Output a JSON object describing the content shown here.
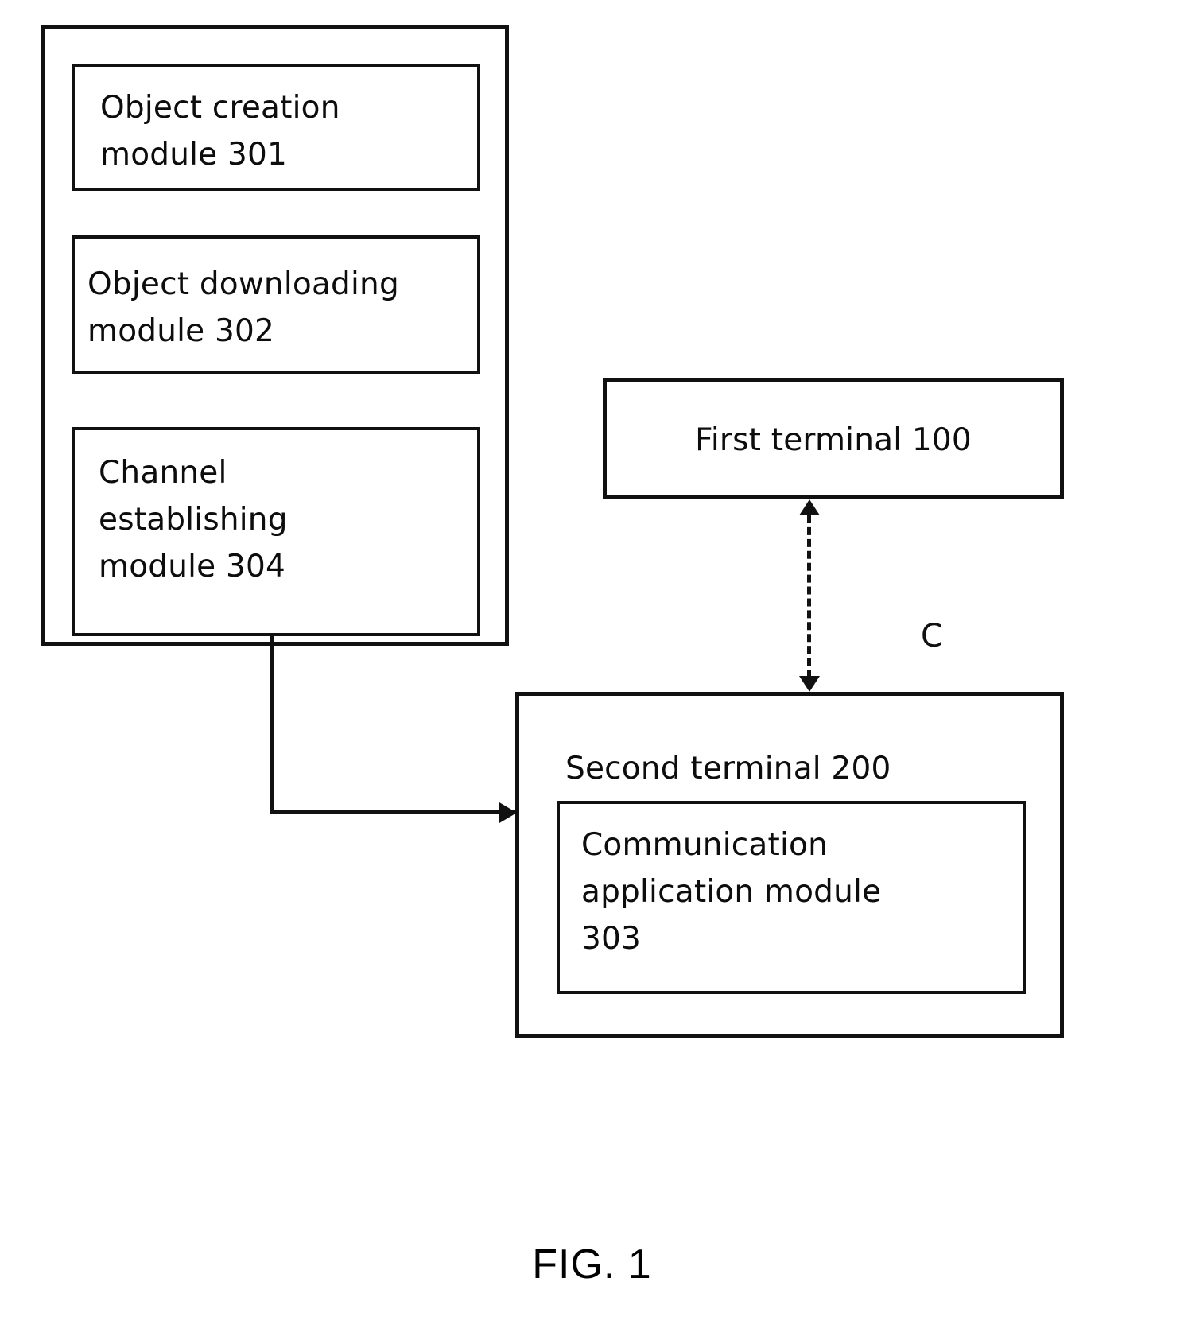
{
  "figure": {
    "caption": "FIG. 1"
  },
  "left_container": {
    "name": "module container",
    "modules": [
      {
        "id": "301",
        "label": "Object creation\nmodule 301"
      },
      {
        "id": "302",
        "label": "Object downloading\nmodule 302"
      },
      {
        "id": "304",
        "label": "Channel\nestablishing\nmodule 304"
      }
    ]
  },
  "first_terminal": {
    "label": "First terminal 100"
  },
  "second_terminal": {
    "label": "Second terminal 200",
    "inner_module": {
      "id": "303",
      "label": "Communication\napplication module\n303"
    }
  },
  "connectors": {
    "channel_label": "C",
    "channel_style": "dashed-bidirectional",
    "module_to_terminal_style": "solid-elbow-arrow"
  },
  "colors": {
    "line": "#111111",
    "background": "#ffffff",
    "text": "#0d0d0d"
  }
}
